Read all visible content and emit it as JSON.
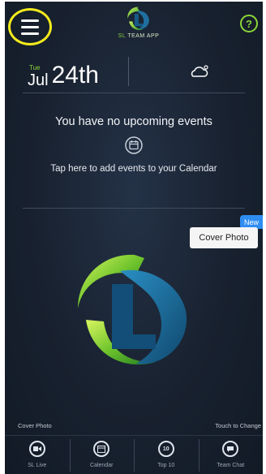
{
  "header": {
    "menu_icon": "hamburger-menu-icon",
    "brand_prefix": "SL",
    "brand_suffix": "TEAM APP",
    "help_label": "?"
  },
  "date": {
    "weekday": "Tue",
    "month": "Jul",
    "day": "24th",
    "weather_icon": "partly-cloudy-icon"
  },
  "events": {
    "empty_message": "You have no upcoming events",
    "add_hint": "Tap here to add events to your Calendar"
  },
  "cover": {
    "button_label": "Cover Photo",
    "new_badge": "New",
    "caption_left": "Cover Photo",
    "caption_right": "Touch to Change"
  },
  "nav": {
    "items": [
      {
        "label": "SL Live",
        "icon": "video-icon"
      },
      {
        "label": "Calendar",
        "icon": "calendar-icon"
      },
      {
        "label": "Top 10",
        "icon": "top-10-icon",
        "glyph": "10"
      },
      {
        "label": "Team Chat",
        "icon": "chat-icon"
      }
    ]
  },
  "colors": {
    "background": "#18212f",
    "accent_green": "#8bd43a",
    "highlight_yellow": "#f3ea1d",
    "badge_blue": "#2f8df2"
  }
}
